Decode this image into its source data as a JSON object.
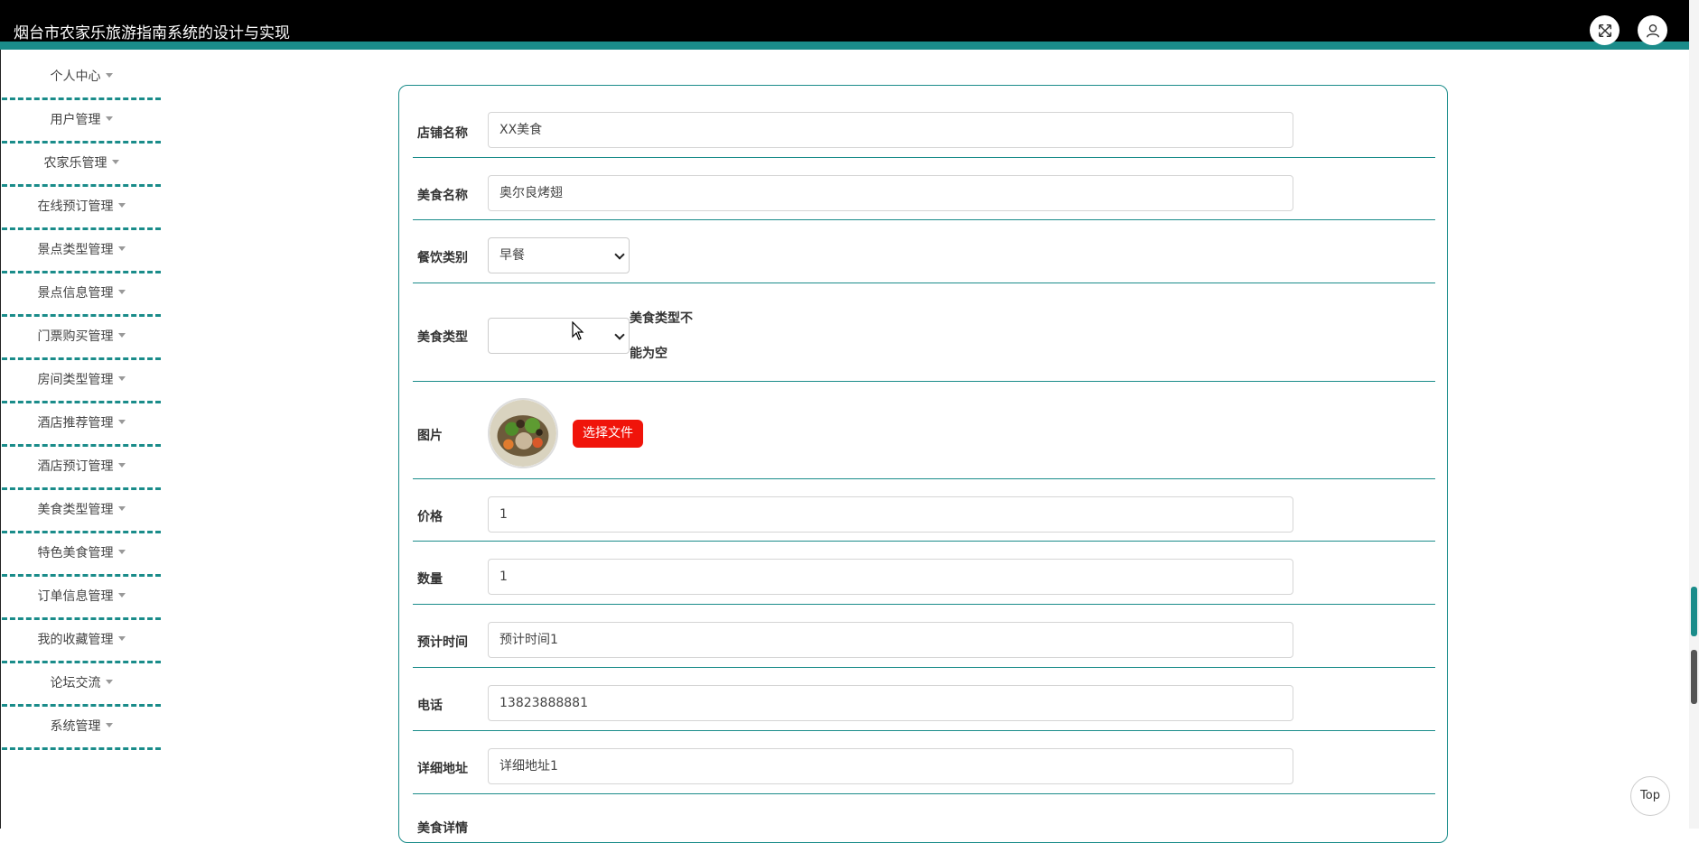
{
  "header": {
    "title": "烟台市农家乐旅游指南系统的设计与实现"
  },
  "sidebar": {
    "items": [
      {
        "label": "个人中心"
      },
      {
        "label": "用户管理"
      },
      {
        "label": "农家乐管理"
      },
      {
        "label": "在线预订管理"
      },
      {
        "label": "景点类型管理"
      },
      {
        "label": "景点信息管理"
      },
      {
        "label": "门票购买管理"
      },
      {
        "label": "房间类型管理"
      },
      {
        "label": "酒店推荐管理"
      },
      {
        "label": "酒店预订管理"
      },
      {
        "label": "美食类型管理"
      },
      {
        "label": "特色美食管理"
      },
      {
        "label": "订单信息管理"
      },
      {
        "label": "我的收藏管理"
      },
      {
        "label": "论坛交流"
      },
      {
        "label": "系统管理"
      }
    ]
  },
  "form": {
    "shop_name": {
      "label": "店铺名称",
      "value": "XX美食"
    },
    "food_name": {
      "label": "美食名称",
      "value": "奥尔良烤翅"
    },
    "dining_category": {
      "label": "餐饮类别",
      "value": "早餐"
    },
    "food_type": {
      "label": "美食类型",
      "value": "",
      "error_line1": "美食类型不",
      "error_line2": "能为空"
    },
    "image": {
      "label": "图片",
      "button": "选择文件"
    },
    "price": {
      "label": "价格",
      "value": "1"
    },
    "quantity": {
      "label": "数量",
      "value": "1"
    },
    "est_time": {
      "label": "预计时间",
      "value": "预计时间1"
    },
    "phone": {
      "label": "电话",
      "value": "13823888881"
    },
    "address": {
      "label": "详细地址",
      "value": "详细地址1"
    },
    "detail": {
      "label": "美食详情"
    }
  },
  "fab": {
    "top_label": "Top"
  },
  "colors": {
    "accent": "#1a8c8a",
    "header_bg": "#000000",
    "button_red": "#f0140a"
  }
}
